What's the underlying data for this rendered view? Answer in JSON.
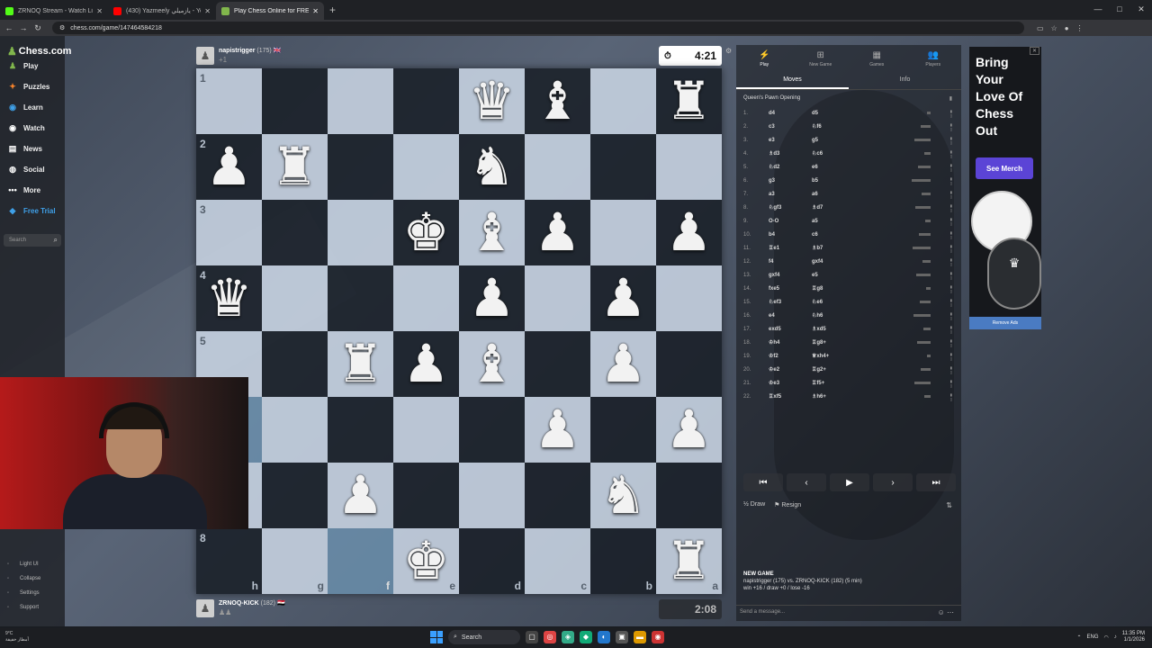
{
  "browser": {
    "tabs": [
      {
        "title": "ZRNOQ Stream - Watch Live on",
        "color": "#53fc18",
        "active": false
      },
      {
        "title": "(430) Yazmeely يازميلي - YouTu",
        "color": "#ff0000",
        "active": false
      },
      {
        "title": "Play Chess Online for FREE - 2",
        "color": "#81b64c",
        "active": true
      }
    ],
    "new_tab": "+",
    "url": "chess.com/game/147464584218",
    "window_controls": [
      "—",
      "□",
      "✕"
    ]
  },
  "leftnav": {
    "logo": "Chess.com",
    "items": [
      {
        "label": "Play",
        "icon": "play-icon",
        "glyph": "♟",
        "color": "#81b64c"
      },
      {
        "label": "Puzzles",
        "icon": "puzzle-icon",
        "glyph": "✦",
        "color": "#f7832b"
      },
      {
        "label": "Learn",
        "icon": "learn-icon",
        "glyph": "◉",
        "color": "#3fa0e8"
      },
      {
        "label": "Watch",
        "icon": "watch-icon",
        "glyph": "◉",
        "color": "#ffffff"
      },
      {
        "label": "News",
        "icon": "news-icon",
        "glyph": "▤",
        "color": "#ffffff"
      },
      {
        "label": "Social",
        "icon": "social-icon",
        "glyph": "◍",
        "color": "#ffffff"
      },
      {
        "label": "More",
        "icon": "more-icon",
        "glyph": "•••",
        "color": "#ffffff"
      },
      {
        "label": "Free Trial",
        "icon": "diamond-icon",
        "glyph": "◆",
        "color": "#3fa0e8"
      }
    ],
    "search_placeholder": "Search",
    "bottom": [
      {
        "label": "Light UI",
        "icon": "light-ui-icon"
      },
      {
        "label": "Collapse",
        "icon": "collapse-icon"
      },
      {
        "label": "Settings",
        "icon": "settings-icon"
      },
      {
        "label": "Support",
        "icon": "support-icon"
      }
    ]
  },
  "board": {
    "ranks": [
      "1",
      "2",
      "3",
      "4",
      "5",
      "6",
      "7",
      "8"
    ],
    "files": [
      "h",
      "g",
      "f",
      "e",
      "d",
      "c",
      "b",
      "a"
    ],
    "pieces": [
      [
        null,
        null,
        null,
        null,
        {
          "t": "♛",
          "c": "w"
        },
        {
          "t": "♝",
          "c": "w"
        },
        null,
        {
          "t": "♜",
          "c": "w"
        }
      ],
      [
        {
          "t": "♟",
          "c": "w"
        },
        {
          "t": "♜",
          "c": "w"
        },
        null,
        null,
        {
          "t": "♞",
          "c": "w"
        },
        null,
        null,
        null
      ],
      [
        null,
        null,
        null,
        {
          "t": "♚",
          "c": "w"
        },
        {
          "t": "♝",
          "c": "w"
        },
        {
          "t": "♟",
          "c": "w"
        },
        null,
        {
          "t": "♟",
          "c": "w"
        }
      ],
      [
        {
          "t": "♛",
          "c": "w"
        },
        null,
        null,
        null,
        {
          "t": "♟",
          "c": "w"
        },
        null,
        {
          "t": "♟",
          "c": "w"
        },
        null
      ],
      [
        null,
        null,
        {
          "t": "♜",
          "c": "w"
        },
        {
          "t": "♟",
          "c": "w"
        },
        {
          "t": "♝",
          "c": "w"
        },
        null,
        {
          "t": "♟",
          "c": "w"
        },
        null
      ],
      [
        null,
        null,
        null,
        null,
        null,
        {
          "t": "♟",
          "c": "w"
        },
        null,
        {
          "t": "♟",
          "c": "w"
        }
      ],
      [
        null,
        null,
        {
          "t": "♟",
          "c": "w"
        },
        null,
        null,
        null,
        {
          "t": "♞",
          "c": "w"
        },
        null
      ],
      [
        null,
        null,
        null,
        {
          "t": "♚",
          "c": "w"
        },
        null,
        null,
        null,
        {
          "t": "♜",
          "c": "w"
        }
      ]
    ],
    "highlight": [
      [
        5,
        0
      ],
      [
        7,
        2
      ]
    ]
  },
  "players": {
    "top": {
      "name": "napistrigger",
      "rating": "(175)",
      "flag": "🇬🇧",
      "caps": "+1",
      "clock": "4:21",
      "clock_icon": "⏱"
    },
    "bottom": {
      "name": "ZRNOQ-KICK",
      "rating": "(182)",
      "flag": "🇪🇬",
      "caps": "♟♟",
      "clock": "2:08"
    }
  },
  "rpanel": {
    "tabs": [
      {
        "label": "Play",
        "glyph": "⚡"
      },
      {
        "label": "New Game",
        "glyph": "⊞"
      },
      {
        "label": "Games",
        "glyph": "▦"
      },
      {
        "label": "Players",
        "glyph": "👥"
      }
    ],
    "subtabs": [
      "Moves",
      "Info"
    ],
    "opening": "Queen's Pawn Opening",
    "moves": [
      {
        "n": "1.",
        "w": "d4",
        "b": "d5"
      },
      {
        "n": "2.",
        "w": "c3",
        "b": "♘f6"
      },
      {
        "n": "3.",
        "w": "e3",
        "b": "g5"
      },
      {
        "n": "4.",
        "w": "♗d3",
        "b": "♘c6"
      },
      {
        "n": "5.",
        "w": "♘d2",
        "b": "e6"
      },
      {
        "n": "6.",
        "w": "g3",
        "b": "b5"
      },
      {
        "n": "7.",
        "w": "a3",
        "b": "a6"
      },
      {
        "n": "8.",
        "w": "♘gf3",
        "b": "♗d7"
      },
      {
        "n": "9.",
        "w": "O-O",
        "b": "a5"
      },
      {
        "n": "10.",
        "w": "b4",
        "b": "c6"
      },
      {
        "n": "11.",
        "w": "♖e1",
        "b": "♗b7"
      },
      {
        "n": "12.",
        "w": "f4",
        "b": "gxf4"
      },
      {
        "n": "13.",
        "w": "gxf4",
        "b": "e5"
      },
      {
        "n": "14.",
        "w": "fxe5",
        "b": "♖g8"
      },
      {
        "n": "15.",
        "w": "♘ef3",
        "b": "♘e6"
      },
      {
        "n": "16.",
        "w": "e4",
        "b": "♘h6"
      },
      {
        "n": "17.",
        "w": "exd5",
        "b": "♗xd5"
      },
      {
        "n": "18.",
        "w": "♔h4",
        "b": "♖g8+"
      },
      {
        "n": "19.",
        "w": "♔f2",
        "b": "♕xh4+"
      },
      {
        "n": "20.",
        "w": "♔e2",
        "b": "♖g2+"
      },
      {
        "n": "21.",
        "w": "♔e3",
        "b": "♖f5+"
      },
      {
        "n": "22.",
        "w": "♖xf5",
        "b": "♗h6+"
      }
    ],
    "controls": [
      "⏮",
      "◀",
      "▶",
      "▶",
      "⏭"
    ],
    "draw": "Draw",
    "resign": "Resign",
    "newgame_title": "NEW GAME",
    "newgame_line1": "napistrigger (175) vs. ZRNOQ-KICK (182) (5 min)",
    "newgame_line2": "win +16 / draw +0 / lose -16",
    "chat_placeholder": "Send a message..."
  },
  "ad": {
    "text_lines": [
      "Bring",
      "Your",
      "Love Of",
      "Chess",
      "Out"
    ],
    "button": "See Merch",
    "remove": "Remove Ads"
  },
  "taskbar": {
    "weather_temp": "9°C",
    "weather_desc": "أمطار خفيفة",
    "search": "Search",
    "lang": "ENG",
    "time": "11:35 PM",
    "date": "1/1/2026"
  }
}
